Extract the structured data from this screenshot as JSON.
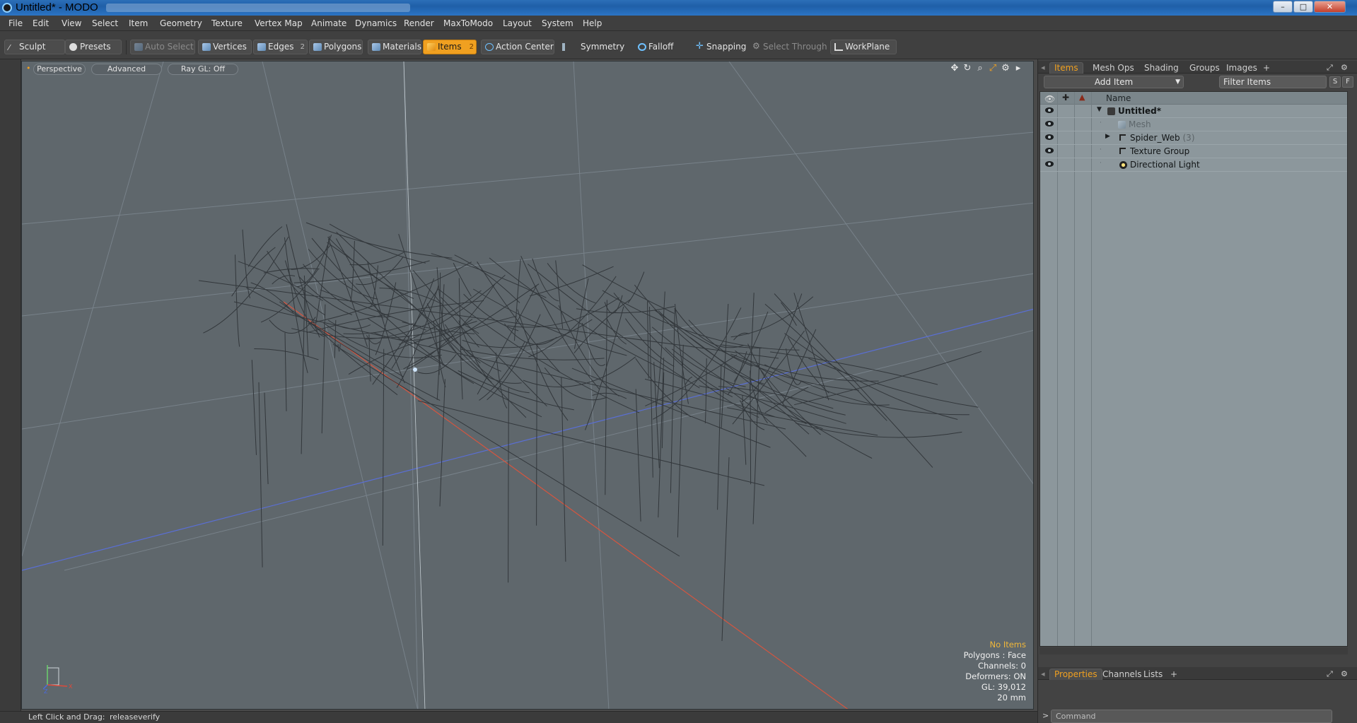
{
  "window": {
    "title": "Untitled* - MODO",
    "minimize": "–",
    "maximize": "□",
    "close": "✕"
  },
  "menu": [
    "File",
    "Edit",
    "View",
    "Select",
    "Item",
    "Geometry",
    "Texture",
    "Vertex Map",
    "Animate",
    "Dynamics",
    "Render",
    "MaxToModo",
    "Layout",
    "System",
    "Help"
  ],
  "toolbar": {
    "sculpt": "Sculpt",
    "presets": "Presets",
    "auto_select": "Auto Select",
    "vertices": "Vertices",
    "edges": "Edges",
    "edges_count": "2",
    "polygons": "Polygons",
    "materials": "Materials",
    "items": "Items",
    "items_count": "2",
    "action_center": "Action Center",
    "symmetry": "Symmetry",
    "falloff": "Falloff",
    "snapping": "Snapping",
    "select_through": "Select Through",
    "workplane": "WorkPlane"
  },
  "viewport": {
    "view_mode": "Perspective",
    "shading": "Advanced",
    "raygl": "Ray GL: Off",
    "info": {
      "selection": "No Items",
      "polygons": "Polygons : Face",
      "channels": "Channels: 0",
      "deformers": "Deformers: ON",
      "gl": "GL: 39,012",
      "scale": "20 mm"
    },
    "gizmo": {
      "y": "Y",
      "x": "X",
      "z": "Z"
    }
  },
  "status": {
    "hint": "Left Click and Drag:",
    "action": "releaseverify"
  },
  "items_panel": {
    "tabs": [
      "Items",
      "Mesh Ops",
      "Shading",
      "Groups",
      "Images"
    ],
    "add_tab": "+",
    "add_item": "Add Item",
    "filter_placeholder": "Filter Items",
    "s_btn": "S",
    "f_btn": "F",
    "column_name": "Name",
    "tree": [
      {
        "label": "Untitled*",
        "count": ""
      },
      {
        "label": "Mesh",
        "count": ""
      },
      {
        "label": "Spider_Web",
        "count": "(3)"
      },
      {
        "label": "Texture Group",
        "count": ""
      },
      {
        "label": "Directional Light",
        "count": ""
      }
    ]
  },
  "properties_panel": {
    "tabs": [
      "Properties",
      "Channels",
      "Lists"
    ],
    "add_tab": "+",
    "command_placeholder": "Command",
    "prompt": ">"
  }
}
